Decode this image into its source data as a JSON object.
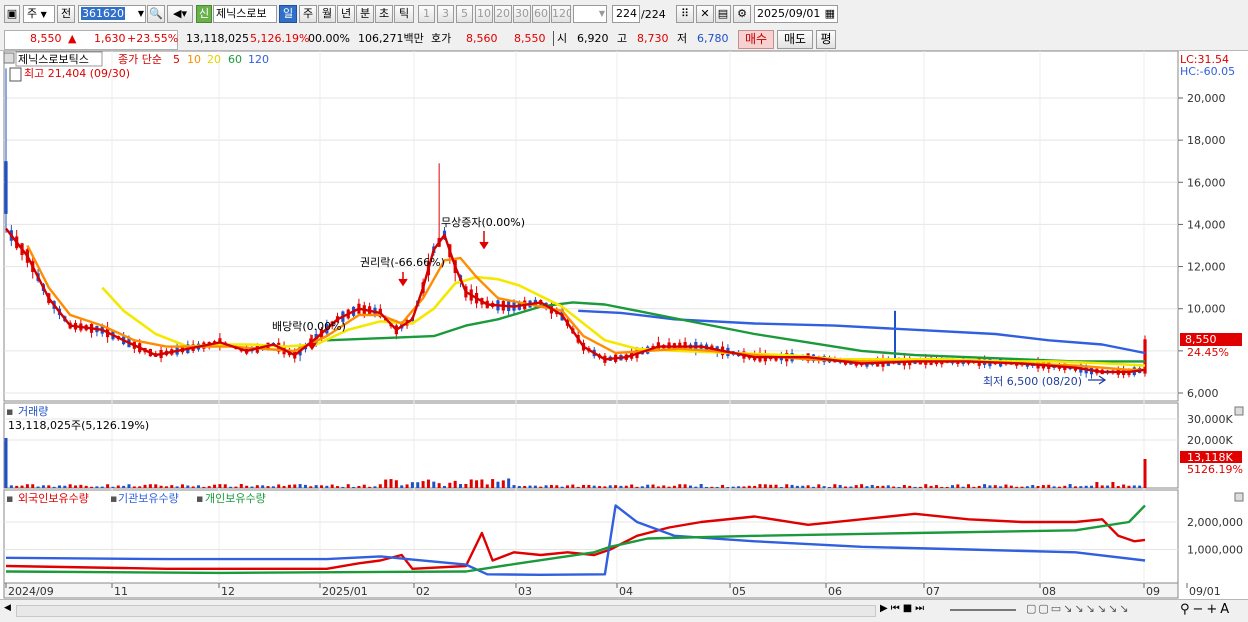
{
  "toolbar": {
    "mode": "주",
    "prev": "전",
    "code": "361620",
    "new_badge": "신",
    "name": "제닉스로보",
    "periods": [
      "일",
      "주",
      "월",
      "년",
      "분",
      "초",
      "틱"
    ],
    "intervals": [
      "1",
      "3",
      "5",
      "10",
      "20",
      "30",
      "60",
      "120"
    ],
    "count": "224",
    "count_total": "/224",
    "date": "2025/09/01"
  },
  "info": {
    "price": "8,550",
    "change_sign": "▲",
    "change": "1,630",
    "change_pct": "+23.55%",
    "volume": "13,118,025",
    "volume_pct": "5,126.19%",
    "rate": "00.00%",
    "amount": "106,271백만",
    "quote_label": "호가",
    "quote_ask": "8,560",
    "quote_bid": "8,550",
    "open_label": "시",
    "open": "6,920",
    "high_label": "고",
    "high": "8,730",
    "low_label": "저",
    "low": "6,780",
    "buy": "매수",
    "sell": "매도",
    "eval": "평"
  },
  "chart_data": [
    {
      "type": "candlestick",
      "title": "제닉스로보틱스",
      "legend": {
        "label": "종가 단순",
        "periods": [
          "5",
          "10",
          "20",
          "60",
          "120"
        ],
        "colors": [
          "#e00000",
          "#ff8c00",
          "#f5e800",
          "#1a9a3a",
          "#3060e0"
        ]
      },
      "ylim": [
        5800,
        21404
      ],
      "yticks": [
        "20,000",
        "18,000",
        "16,000",
        "14,000",
        "12,000",
        "10,000",
        "",
        "6,000"
      ],
      "lc": "LC:31.54",
      "hc": "HC:-60.05",
      "high_note": "최고 21,404 (09/30)",
      "low_note": "최저 6,500 (08/20)",
      "price_tag": "8,550",
      "pct_tag": "24.45%",
      "events": [
        "권리락(-66.66%)",
        "무상증자(0.00%)",
        "배당락(0.00%)"
      ],
      "ma5": [
        [
          0,
          13800
        ],
        [
          4,
          12500
        ],
        [
          8,
          10500
        ],
        [
          12,
          9200
        ],
        [
          18,
          9000
        ],
        [
          22,
          8500
        ],
        [
          28,
          7800
        ],
        [
          34,
          8100
        ],
        [
          40,
          8400
        ],
        [
          45,
          8000
        ],
        [
          50,
          8300
        ],
        [
          54,
          7800
        ],
        [
          58,
          8600
        ],
        [
          62,
          9500
        ],
        [
          66,
          10000
        ],
        [
          70,
          9800
        ],
        [
          73,
          9000
        ],
        [
          76,
          9500
        ],
        [
          78,
          11000
        ],
        [
          80,
          12800
        ],
        [
          82,
          13500
        ],
        [
          84,
          12000
        ],
        [
          86,
          10800
        ],
        [
          90,
          10200
        ],
        [
          95,
          10100
        ],
        [
          100,
          10300
        ],
        [
          104,
          9700
        ],
        [
          108,
          8200
        ],
        [
          112,
          7600
        ],
        [
          116,
          7700
        ],
        [
          122,
          8200
        ],
        [
          130,
          8200
        ],
        [
          140,
          7700
        ],
        [
          150,
          7700
        ],
        [
          160,
          7400
        ],
        [
          170,
          7500
        ],
        [
          180,
          7500
        ],
        [
          190,
          7400
        ],
        [
          200,
          7200
        ],
        [
          205,
          7000
        ],
        [
          210,
          7000
        ],
        [
          213,
          7100
        ]
      ],
      "ma10": [
        [
          4,
          13000
        ],
        [
          8,
          11000
        ],
        [
          12,
          9700
        ],
        [
          18,
          9200
        ],
        [
          24,
          8500
        ],
        [
          30,
          8200
        ],
        [
          36,
          8200
        ],
        [
          42,
          8200
        ],
        [
          48,
          8100
        ],
        [
          54,
          8000
        ],
        [
          60,
          8700
        ],
        [
          66,
          9700
        ],
        [
          70,
          9700
        ],
        [
          74,
          9300
        ],
        [
          78,
          10500
        ],
        [
          82,
          12300
        ],
        [
          85,
          12400
        ],
        [
          88,
          11500
        ],
        [
          92,
          10500
        ],
        [
          98,
          10200
        ],
        [
          104,
          9900
        ],
        [
          108,
          8700
        ],
        [
          114,
          7900
        ],
        [
          120,
          8000
        ],
        [
          126,
          8100
        ],
        [
          132,
          8000
        ],
        [
          140,
          7800
        ],
        [
          150,
          7600
        ],
        [
          160,
          7500
        ],
        [
          170,
          7500
        ],
        [
          180,
          7500
        ],
        [
          190,
          7400
        ],
        [
          200,
          7300
        ],
        [
          210,
          7100
        ],
        [
          213,
          7100
        ]
      ],
      "ma20": [
        [
          18,
          11000
        ],
        [
          22,
          9900
        ],
        [
          28,
          8800
        ],
        [
          34,
          8200
        ],
        [
          40,
          8300
        ],
        [
          46,
          8300
        ],
        [
          52,
          8200
        ],
        [
          58,
          8300
        ],
        [
          64,
          9000
        ],
        [
          70,
          9400
        ],
        [
          76,
          9300
        ],
        [
          80,
          10000
        ],
        [
          84,
          11200
        ],
        [
          88,
          11500
        ],
        [
          92,
          11400
        ],
        [
          96,
          11100
        ],
        [
          100,
          10600
        ],
        [
          104,
          10100
        ],
        [
          108,
          9300
        ],
        [
          112,
          8500
        ],
        [
          118,
          8100
        ],
        [
          126,
          8000
        ],
        [
          136,
          7900
        ],
        [
          146,
          7800
        ],
        [
          156,
          7600
        ],
        [
          166,
          7600
        ],
        [
          176,
          7600
        ],
        [
          186,
          7500
        ],
        [
          196,
          7500
        ],
        [
          206,
          7400
        ],
        [
          213,
          7300
        ]
      ],
      "ma60": [
        [
          60,
          8500
        ],
        [
          70,
          8600
        ],
        [
          80,
          8700
        ],
        [
          86,
          9200
        ],
        [
          92,
          9500
        ],
        [
          100,
          10100
        ],
        [
          106,
          10300
        ],
        [
          112,
          10200
        ],
        [
          120,
          9800
        ],
        [
          130,
          9300
        ],
        [
          140,
          8800
        ],
        [
          150,
          8400
        ],
        [
          160,
          8000
        ],
        [
          170,
          7800
        ],
        [
          180,
          7700
        ],
        [
          190,
          7600
        ],
        [
          200,
          7500
        ],
        [
          210,
          7500
        ],
        [
          213,
          7500
        ]
      ],
      "ma120": [
        [
          107,
          9900
        ],
        [
          115,
          9800
        ],
        [
          125,
          9500
        ],
        [
          140,
          9300
        ],
        [
          155,
          9200
        ],
        [
          170,
          9000
        ],
        [
          185,
          8800
        ],
        [
          195,
          8500
        ],
        [
          205,
          8300
        ],
        [
          213,
          7900
        ]
      ],
      "x_labels": [
        "2024/09",
        "11",
        "12",
        "2025/01",
        "02",
        "03",
        "04",
        "05",
        "06",
        "07",
        "08",
        "09",
        "09/01"
      ],
      "vol": {
        "title": "거래량",
        "value_label": "13,118,025주(5,126.19%)",
        "yticks": [
          "30,000K",
          "20,000K"
        ],
        "tag": "13,118K",
        "tag_pct": "5126.19%"
      },
      "holdings": {
        "series": [
          {
            "name": "외국인보유수량",
            "color": "#e00000",
            "values": [
              [
                0,
                400000
              ],
              [
                30,
                300000
              ],
              [
                60,
                300000
              ],
              [
                66,
                500000
              ],
              [
                70,
                600000
              ],
              [
                74,
                800000
              ],
              [
                76,
                300000
              ],
              [
                86,
                400000
              ],
              [
                89,
                1600000
              ],
              [
                91,
                600000
              ],
              [
                95,
                900000
              ],
              [
                100,
                800000
              ],
              [
                105,
                900000
              ],
              [
                110,
                800000
              ],
              [
                113,
                1000000
              ],
              [
                118,
                1500000
              ],
              [
                124,
                1800000
              ],
              [
                130,
                2000000
              ],
              [
                140,
                2200000
              ],
              [
                150,
                1900000
              ],
              [
                160,
                2100000
              ],
              [
                170,
                2300000
              ],
              [
                180,
                2100000
              ],
              [
                190,
                2000000
              ],
              [
                200,
                2000000
              ],
              [
                205,
                2100000
              ],
              [
                208,
                1500000
              ],
              [
                211,
                1300000
              ],
              [
                213,
                1350000
              ]
            ]
          },
          {
            "name": "기관보유수량",
            "color": "#3060e0",
            "values": [
              [
                0,
                700000
              ],
              [
                30,
                650000
              ],
              [
                60,
                650000
              ],
              [
                70,
                750000
              ],
              [
                75,
                650000
              ],
              [
                86,
                450000
              ],
              [
                90,
                100000
              ],
              [
                100,
                80000
              ],
              [
                112,
                100000
              ],
              [
                114,
                2600000
              ],
              [
                118,
                2000000
              ],
              [
                125,
                1500000
              ],
              [
                140,
                1300000
              ],
              [
                160,
                1100000
              ],
              [
                180,
                1000000
              ],
              [
                200,
                900000
              ],
              [
                213,
                600000
              ]
            ]
          },
          {
            "name": "개인보유수량",
            "color": "#1a9a3a",
            "values": [
              [
                0,
                200000
              ],
              [
                40,
                150000
              ],
              [
                86,
                200000
              ],
              [
                96,
                500000
              ],
              [
                110,
                900000
              ],
              [
                113,
                1100000
              ],
              [
                120,
                1400000
              ],
              [
                140,
                1500000
              ],
              [
                170,
                1600000
              ],
              [
                200,
                1700000
              ],
              [
                210,
                2000000
              ],
              [
                213,
                2600000
              ]
            ]
          }
        ],
        "yticks": [
          "2,000,000",
          "1,000,000"
        ]
      }
    }
  ]
}
